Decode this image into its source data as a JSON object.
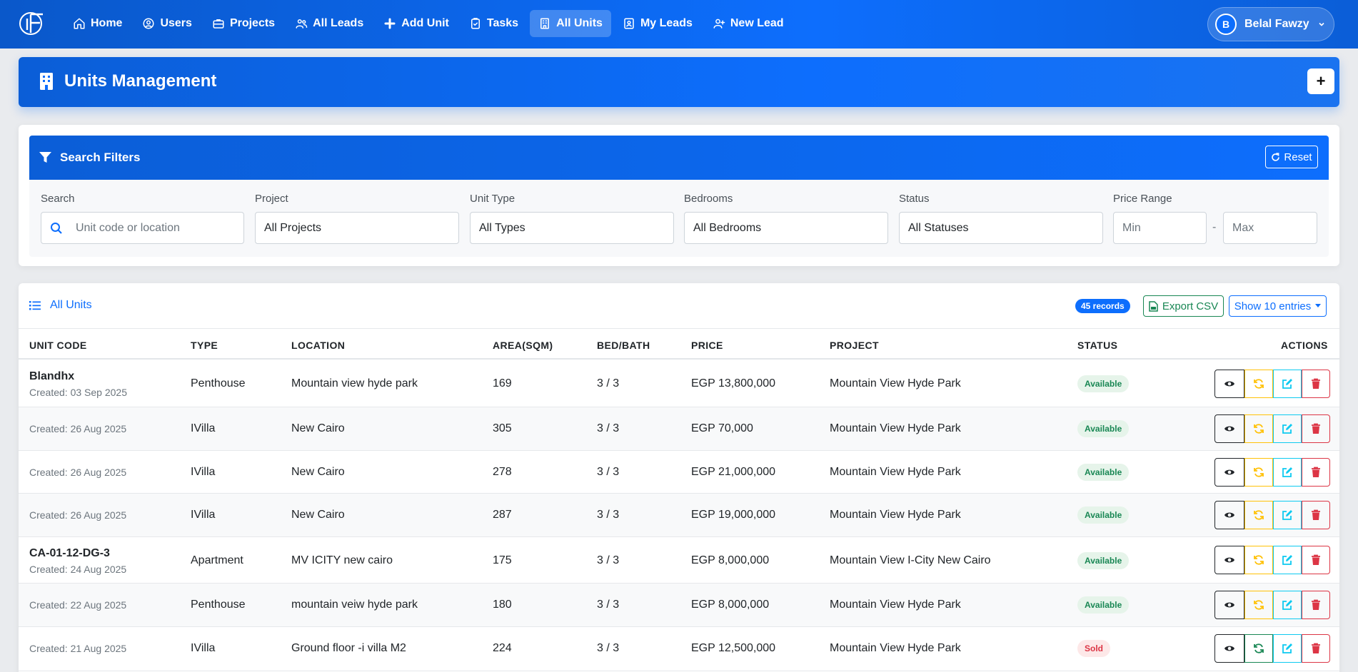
{
  "nav": {
    "items": [
      {
        "label": "Home",
        "icon": "home-icon"
      },
      {
        "label": "Users",
        "icon": "user-circle-icon"
      },
      {
        "label": "Projects",
        "icon": "briefcase-icon"
      },
      {
        "label": "All Leads",
        "icon": "users-icon"
      },
      {
        "label": "Add Unit",
        "icon": "plus-icon"
      },
      {
        "label": "Tasks",
        "icon": "clipboard-check-icon"
      },
      {
        "label": "All Units",
        "icon": "building-icon",
        "active": true
      },
      {
        "label": "My Leads",
        "icon": "id-badge-icon"
      },
      {
        "label": "New Lead",
        "icon": "user-plus-icon"
      }
    ],
    "user": {
      "initial": "B",
      "name": "Belal Fawzy"
    }
  },
  "header": {
    "title": "Units Management",
    "add_label": "+"
  },
  "filters": {
    "title": "Search Filters",
    "reset_label": "Reset",
    "search": {
      "label": "Search",
      "placeholder": "Unit code or location"
    },
    "project": {
      "label": "Project",
      "value": "All Projects"
    },
    "unit_type": {
      "label": "Unit Type",
      "value": "All Types"
    },
    "bedrooms": {
      "label": "Bedrooms",
      "value": "All Bedrooms"
    },
    "status": {
      "label": "Status",
      "value": "All Statuses"
    },
    "price": {
      "label": "Price Range",
      "min_placeholder": "Min",
      "max_placeholder": "Max",
      "separator": "-"
    }
  },
  "table": {
    "title": "All Units",
    "records_badge": "45 records",
    "export_label": "Export CSV",
    "show_label": "Show 10 entries",
    "headers": [
      "UNIT CODE",
      "TYPE",
      "LOCATION",
      "AREA(SQM)",
      "BED/BATH",
      "PRICE",
      "PROJECT",
      "STATUS",
      "ACTIONS"
    ],
    "rows": [
      {
        "code": "Blandhx",
        "created": "Created: 03 Sep 2025",
        "type": "Penthouse",
        "location": "Mountain view hyde park",
        "area": "169",
        "bedbath": "3 / 3",
        "price": "EGP 13,800,000",
        "project": "Mountain View Hyde Park",
        "status": "Available"
      },
      {
        "code": "",
        "created": "Created: 26 Aug 2025",
        "type": "IVilla",
        "location": "New Cairo",
        "area": "305",
        "bedbath": "3 / 3",
        "price": "EGP 70,000",
        "project": "Mountain View Hyde Park",
        "status": "Available"
      },
      {
        "code": "",
        "created": "Created: 26 Aug 2025",
        "type": "IVilla",
        "location": "New Cairo",
        "area": "278",
        "bedbath": "3 / 3",
        "price": "EGP 21,000,000",
        "project": "Mountain View Hyde Park",
        "status": "Available"
      },
      {
        "code": "",
        "created": "Created: 26 Aug 2025",
        "type": "IVilla",
        "location": "New Cairo",
        "area": "287",
        "bedbath": "3 / 3",
        "price": "EGP 19,000,000",
        "project": "Mountain View Hyde Park",
        "status": "Available"
      },
      {
        "code": "CA-01-12-DG-3",
        "created": "Created: 24 Aug 2025",
        "type": "Apartment",
        "location": "MV ICITY new cairo",
        "area": "175",
        "bedbath": "3 / 3",
        "price": "EGP 8,000,000",
        "project": "Mountain View I-City New Cairo",
        "status": "Available"
      },
      {
        "code": "",
        "created": "Created: 22 Aug 2025",
        "type": "Penthouse",
        "location": "mountain veiw hyde park",
        "area": "180",
        "bedbath": "3 / 3",
        "price": "EGP 8,000,000",
        "project": "Mountain View Hyde Park",
        "status": "Available"
      },
      {
        "code": "",
        "created": "Created: 21 Aug 2025",
        "type": "IVilla",
        "location": "Ground floor -i villa M2",
        "area": "224",
        "bedbath": "3 / 3",
        "price": "EGP 12,500,000",
        "project": "Mountain View Hyde Park",
        "status": "Sold"
      }
    ]
  },
  "colors": {
    "primary": "#0d6efd",
    "success": "#198754",
    "warning": "#ffc107",
    "info": "#0dcaf0",
    "danger": "#dc3545"
  }
}
